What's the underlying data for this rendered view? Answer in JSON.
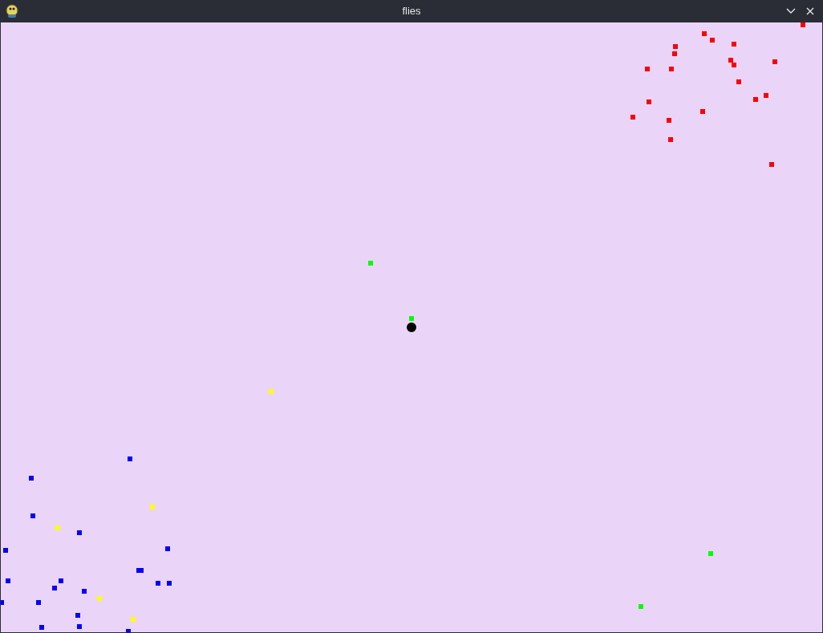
{
  "window": {
    "title": "flies"
  },
  "flies": [
    {
      "color": "#ff0000"
    },
    {
      "color": "#ff0000"
    },
    {
      "color": "#ff0000"
    },
    {
      "color": "#ff0000"
    },
    {
      "color": "#ff0000"
    },
    {
      "color": "#ff0000"
    },
    {
      "color": "#ff0000"
    },
    {
      "color": "#ff0000"
    },
    {
      "color": "#ff0000"
    },
    {
      "color": "#ff0000"
    },
    {
      "color": "#ff0000"
    },
    {
      "color": "#ff0000"
    },
    {
      "color": "#ff0000"
    },
    {
      "color": "#ff0000"
    },
    {
      "color": "#ff0000"
    },
    {
      "color": "#ff0000"
    },
    {
      "color": "#ff0000"
    },
    {
      "color": "#ff0000"
    },
    {
      "color": "#ff0000"
    },
    {
      "color": "#ff0000"
    },
    {
      "color": "#00ff00"
    },
    {
      "color": "#00ff00"
    },
    {
      "color": "#00ff00"
    },
    {
      "color": "#00ff00"
    },
    {
      "color": "#ffff00"
    },
    {
      "color": "#ffff00"
    },
    {
      "color": "#ffff00"
    },
    {
      "color": "#ffff00"
    },
    {
      "color": "#ffff00"
    },
    {
      "color": "#0000ff"
    },
    {
      "color": "#0000ff"
    },
    {
      "color": "#0000ff"
    },
    {
      "color": "#0000ff"
    },
    {
      "color": "#0000ff"
    },
    {
      "color": "#0000ff"
    },
    {
      "color": "#0000ff"
    },
    {
      "color": "#0000ff"
    },
    {
      "color": "#0000ff"
    },
    {
      "color": "#0000ff"
    },
    {
      "color": "#0000ff"
    },
    {
      "color": "#0000ff"
    },
    {
      "color": "#0000ff"
    },
    {
      "color": "#0000ff"
    },
    {
      "color": "#0000ff"
    },
    {
      "color": "#0000ff"
    },
    {
      "color": "#0000ff"
    },
    {
      "color": "#0000ff"
    },
    {
      "color": "#0000ff"
    },
    {
      "color": "#0000ff"
    }
  ]
}
